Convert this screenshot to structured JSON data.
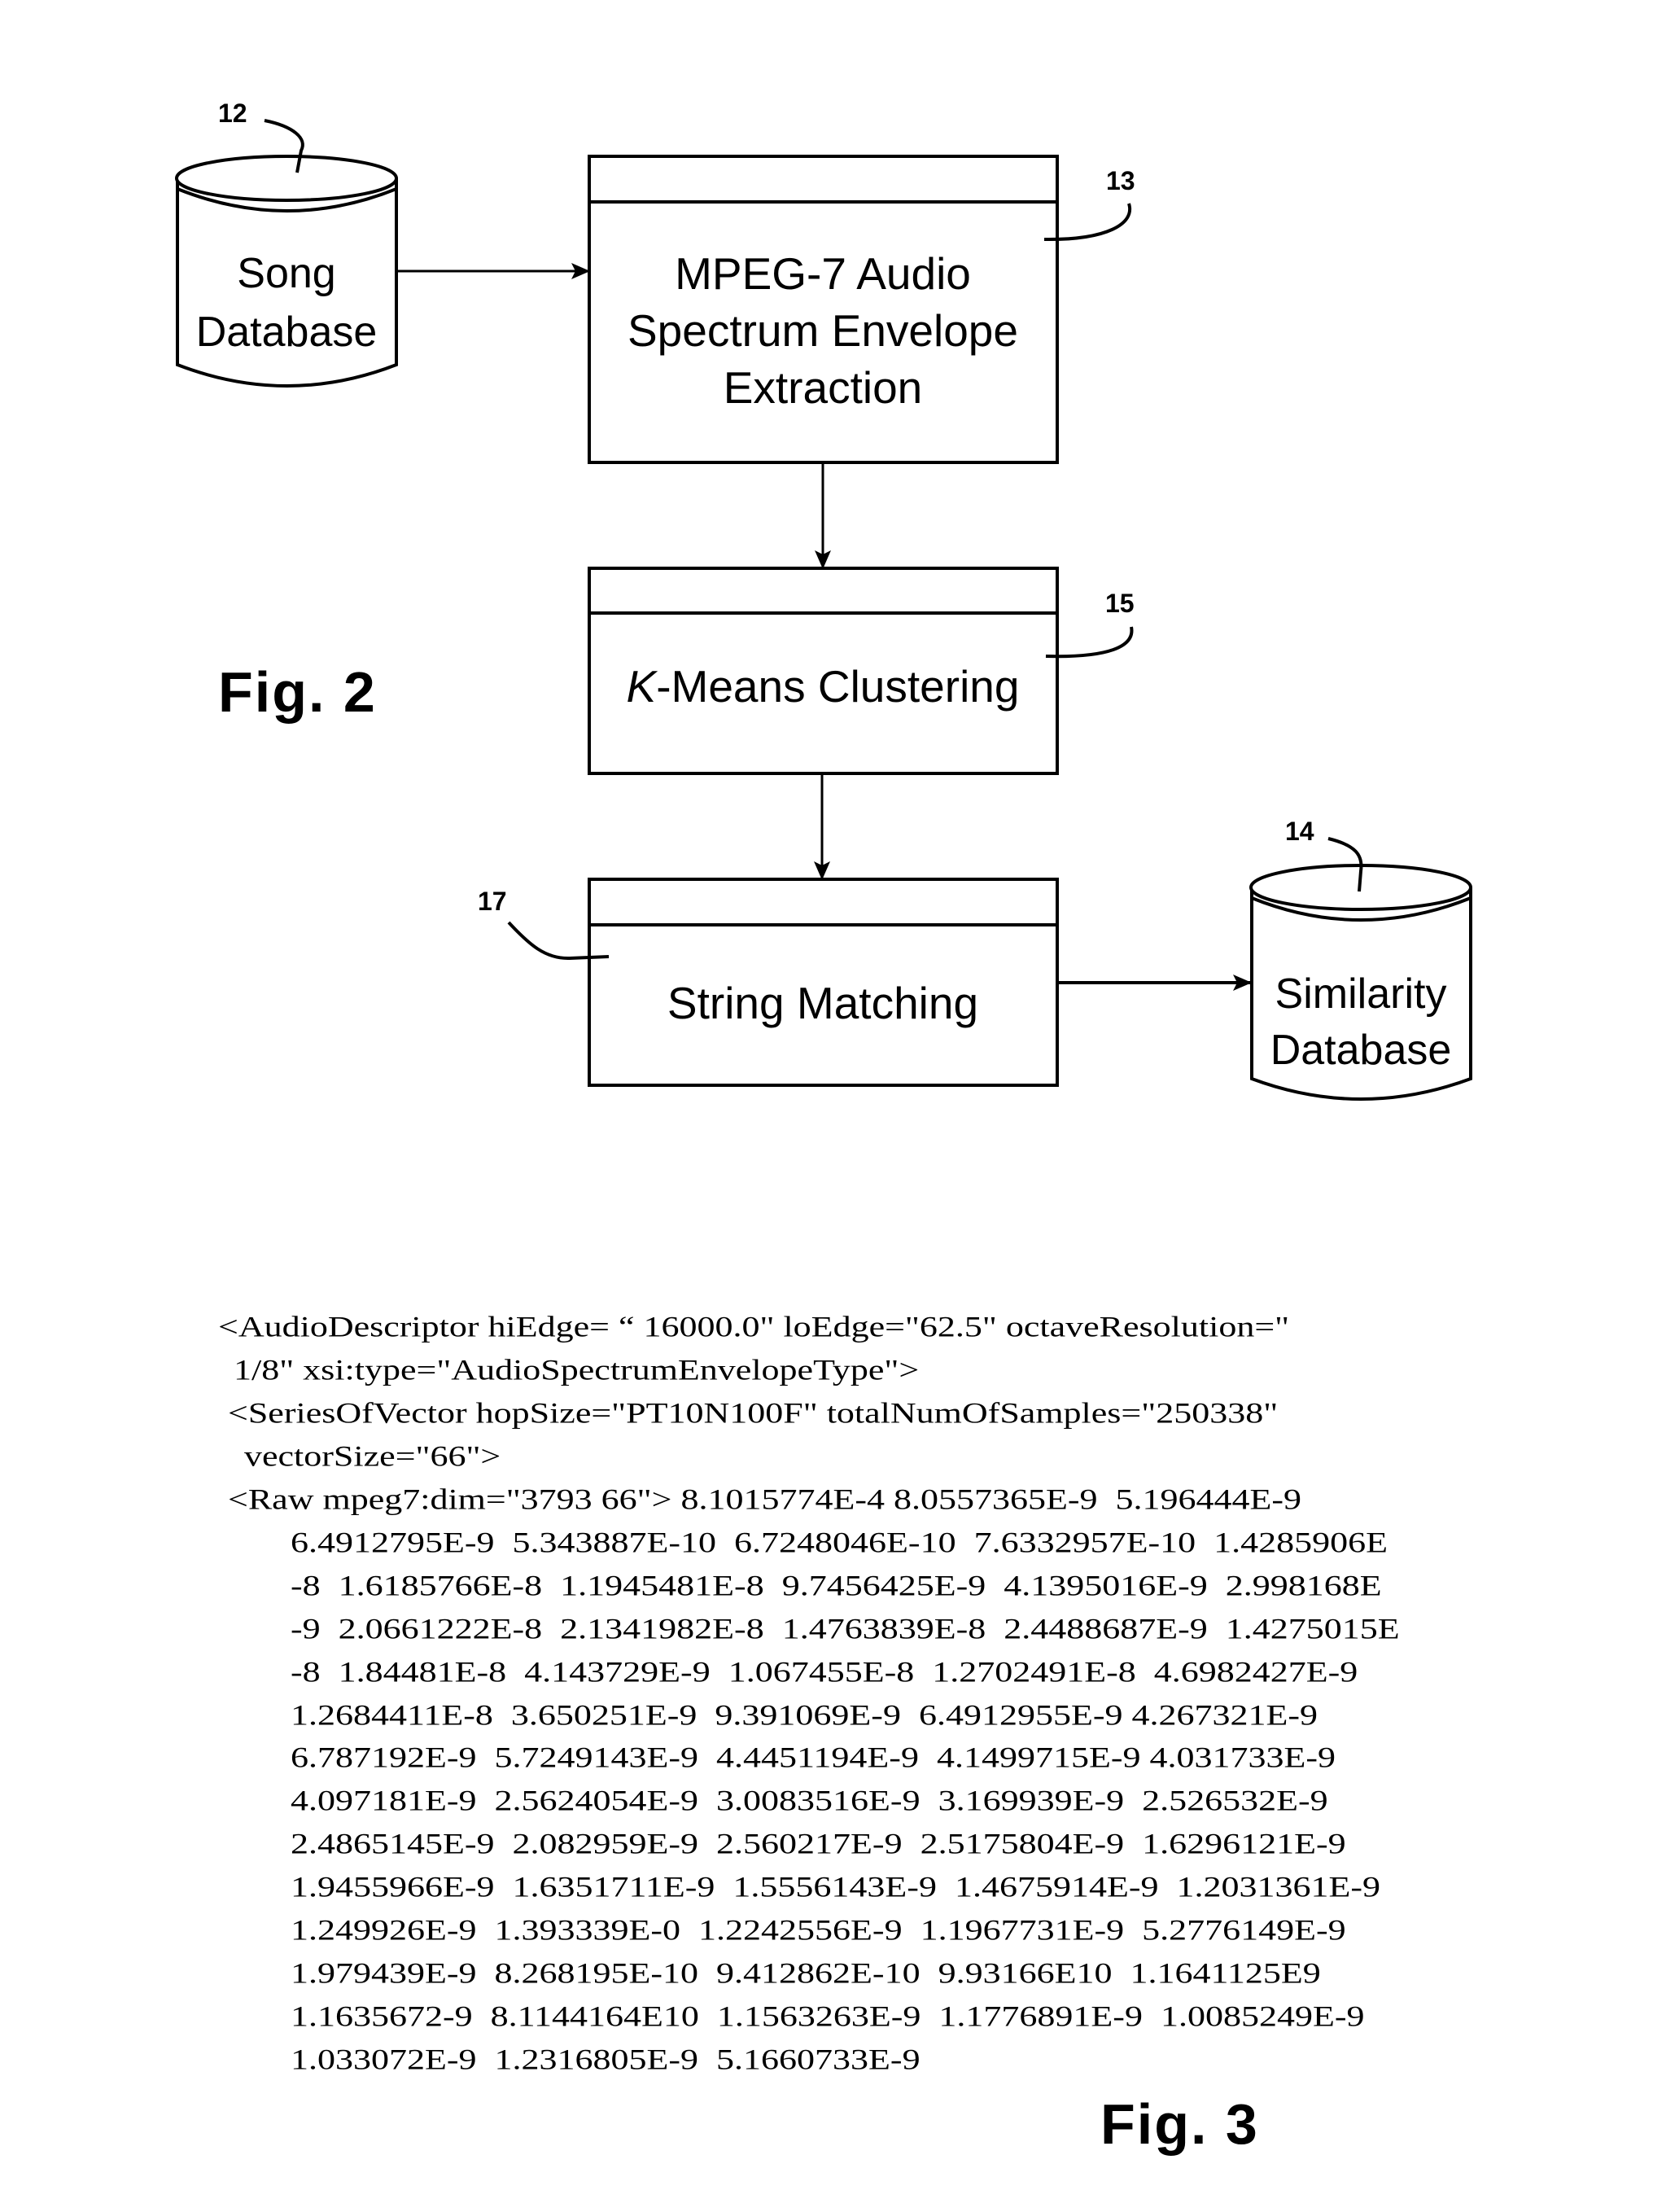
{
  "figure2": {
    "caption": "Fig. 2",
    "nodes": {
      "song_database": {
        "ref": "12",
        "lines": [
          "Song",
          "Database"
        ],
        "shape": "cylinder"
      },
      "ase_extraction": {
        "ref": "13",
        "lines": [
          "MPEG-7 Audio",
          "Spectrum Envelope",
          "Extraction"
        ],
        "shape": "process-box"
      },
      "kmeans": {
        "ref": "15",
        "italic_prefix": "K",
        "rest": "-Means Clustering",
        "shape": "process-box"
      },
      "string_matching": {
        "ref": "17",
        "lines": [
          "String Matching"
        ],
        "shape": "process-box"
      },
      "similarity_database": {
        "ref": "14",
        "lines": [
          "Similarity",
          "Database"
        ],
        "shape": "cylinder"
      }
    },
    "edges": [
      {
        "from": "song_database",
        "to": "ase_extraction"
      },
      {
        "from": "ase_extraction",
        "to": "kmeans"
      },
      {
        "from": "kmeans",
        "to": "string_matching"
      },
      {
        "from": "string_matching",
        "to": "similarity_database"
      }
    ]
  },
  "figure3": {
    "caption": "Fig. 3",
    "lines": [
      "<AudioDescriptor hiEdge= “ 16000.0\" loEdge=\"62.5\" octaveResolution=\"",
      "1/8\" xsi:type=\"AudioSpectrumEnvelopeType\">",
      "<SeriesOfVector hopSize=\"PT10N100F\" totalNumOfSamples=\"250338\"",
      "vectorSize=\"66\">",
      "<Raw mpeg7:dim=\"3793 66\"> 8.1015774E-4 8.0557365E-9  5.196444E-9",
      "6.4912795E-9  5.343887E-10  6.7248046E-10  7.6332957E-10  1.4285906E",
      "-8  1.6185766E-8  1.1945481E-8  9.7456425E-9  4.1395016E-9  2.998168E",
      "-9  2.0661222E-8  2.1341982E-8  1.4763839E-8  2.4488687E-9  1.4275015E",
      "-8  1.84481E-8  4.143729E-9  1.067455E-8  1.2702491E-8  4.6982427E-9",
      "1.2684411E-8  3.650251E-9  9.391069E-9  6.4912955E-9 4.267321E-9",
      "6.787192E-9  5.7249143E-9  4.4451194E-9  4.1499715E-9 4.031733E-9",
      "4.097181E-9  2.5624054E-9  3.0083516E-9  3.169939E-9  2.526532E-9",
      "2.4865145E-9  2.082959E-9  2.560217E-9  2.5175804E-9  1.6296121E-9",
      "1.9455966E-9  1.6351711E-9  1.5556143E-9  1.4675914E-9  1.2031361E-9",
      "1.249926E-9  1.393339E-0  1.2242556E-9  1.1967731E-9  5.2776149E-9",
      "1.979439E-9  8.268195E-10  9.412862E-10  9.93166E10  1.1641125E9",
      "1.1635672-9  8.1144164E10  1.1563263E-9  1.1776891E-9  1.0085249E-9",
      "1.033072E-9  1.2316805E-9  5.1660733E-9"
    ]
  }
}
